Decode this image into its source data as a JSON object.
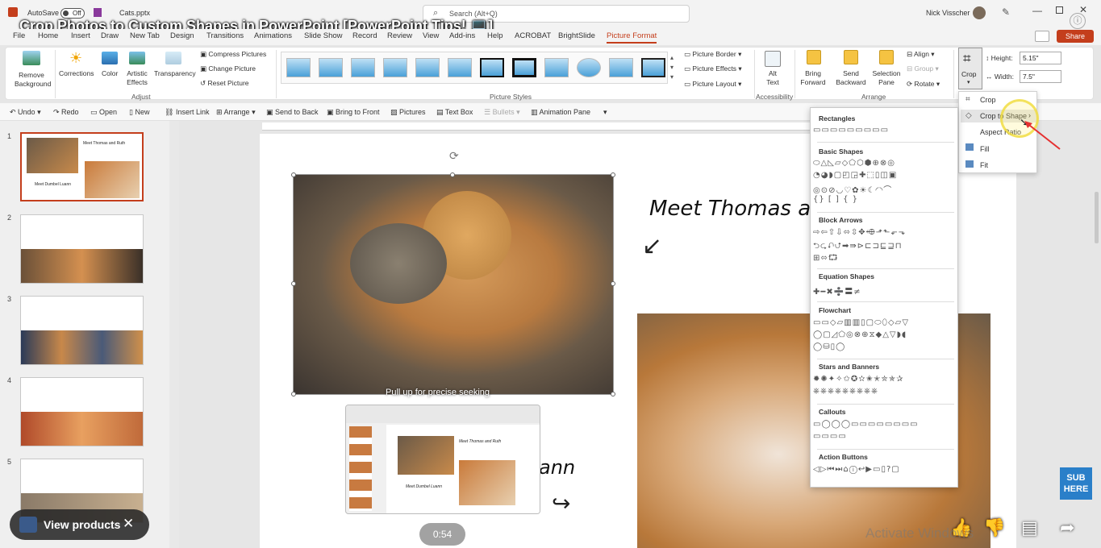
{
  "titlebar": {
    "autosave": "AutoSave",
    "toggle": "Off",
    "filename": "Cats.pptx",
    "search_placeholder": "Search (Alt+Q)",
    "user": "Nick Visscher"
  },
  "video_title": "Crop Photos to Custom Shapes in PowerPoint [PowerPoint Tips! 💻]",
  "tabs": [
    "File",
    "Home",
    "Insert",
    "Draw",
    "New Tab",
    "Design",
    "Transitions",
    "Animations",
    "Slide Show",
    "Record",
    "Review",
    "View",
    "Add-ins",
    "Help",
    "ACROBAT",
    "BrightSlide",
    "Picture Format"
  ],
  "active_tab": "Picture Format",
  "share": "Share",
  "ribbon": {
    "remove_bg": "Remove Background",
    "corrections": "Corrections",
    "color": "Color",
    "artistic": "Artistic Effects",
    "transparency": "Transparency",
    "compress": "Compress Pictures",
    "change": "Change Picture",
    "reset": "Reset Picture",
    "adjust": "Adjust",
    "picture_styles": "Picture Styles",
    "border": "Picture Border",
    "effects": "Picture Effects",
    "layout": "Picture Layout",
    "alt_text": "Alt Text",
    "accessibility": "Accessibility",
    "bring_forward": "Bring Forward",
    "send_backward": "Send Backward",
    "selection_pane": "Selection Pane",
    "align": "Align",
    "group": "Group",
    "rotate": "Rotate",
    "arrange": "Arrange",
    "crop": "Crop",
    "height_label": "Height:",
    "height_val": "5.15\"",
    "width_label": "Width:",
    "width_val": "7.5\""
  },
  "quick_access": [
    "Undo",
    "Redo",
    "Open",
    "New",
    "Insert Link",
    "Arrange",
    "Send to Back",
    "Bring to Front",
    "Pictures",
    "Text Box",
    "Bullets",
    "Animation Pane"
  ],
  "slides": [
    "1",
    "2",
    "3",
    "4",
    "5"
  ],
  "slide": {
    "heading": "Meet Thomas a",
    "heading2": "ann",
    "thumb1_title": "Meet Thomas and Ruth",
    "thumb1_sub": "Meet Dumbel Luann"
  },
  "seek_hint": "Pull up for precise seeking",
  "crop_menu": [
    "Crop",
    "Crop to Shape",
    "Aspect Ratio",
    "Fill",
    "Fit"
  ],
  "shapes_panel": {
    "sections": [
      "Rectangles",
      "Basic Shapes",
      "Block Arrows",
      "Equation Shapes",
      "Flowchart",
      "Stars and Banners",
      "Callouts",
      "Action Buttons"
    ]
  },
  "overlay": {
    "view_products": "View products",
    "time": "0:54",
    "activate": "Activate Windows",
    "sub": "SUB HERE"
  }
}
